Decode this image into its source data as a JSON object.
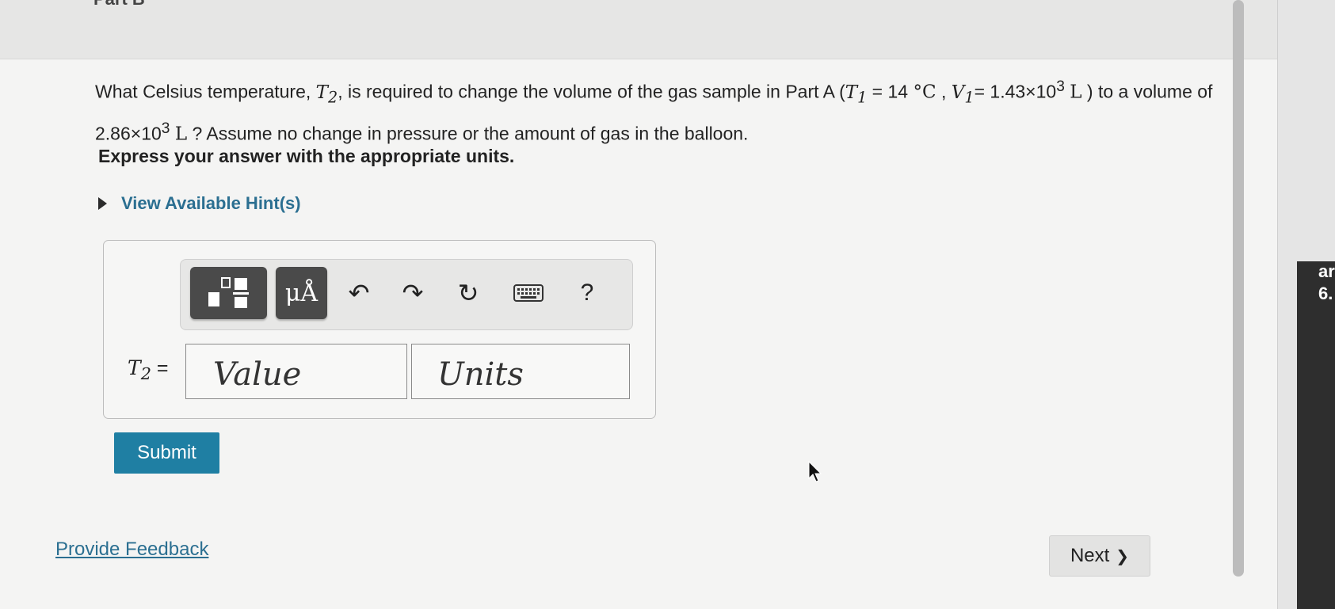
{
  "header": {
    "part_label": "Part B"
  },
  "question": {
    "t1": "What Celsius temperature,",
    "var": "T",
    "sub2": "2",
    "t2": ", is required to change the volume of the gas sample in Part A (",
    "sub1": "1",
    "eq14": " = 14",
    "degc": "°C",
    "comma": " , ",
    "vvar": "V",
    "eqv": "= 1.43×10",
    "exp3": "3",
    "unitL": "L",
    "t3": " ) to a volume of 2.86×10",
    "t4": " ? Assume no change in pressure or the amount of gas in the balloon."
  },
  "instruction": "Express your answer with the appropriate units.",
  "hints_label": "View Available Hint(s)",
  "toolbar": {
    "units_label": "μÅ",
    "undo_glyph": "↶",
    "redo_glyph": "↷",
    "reset_glyph": "↻",
    "help_label": "?",
    "icons": [
      "templates-icon",
      "units-icon",
      "undo-icon",
      "redo-icon",
      "reset-icon",
      "keyboard-icon",
      "help-icon"
    ]
  },
  "answer": {
    "var": "T",
    "sub": "2",
    "equals": " =",
    "value_placeholder": "Value",
    "units_placeholder": "Units"
  },
  "submit_label": "Submit",
  "feedback_label": "Provide Feedback",
  "next_label": "Next",
  "next_glyph": "❯",
  "edge_text": [
    "ar",
    "6."
  ],
  "colors": {
    "accent": "#1f7fa3",
    "link": "#2b6f91",
    "toolbar_button": "#4a4a4a"
  }
}
